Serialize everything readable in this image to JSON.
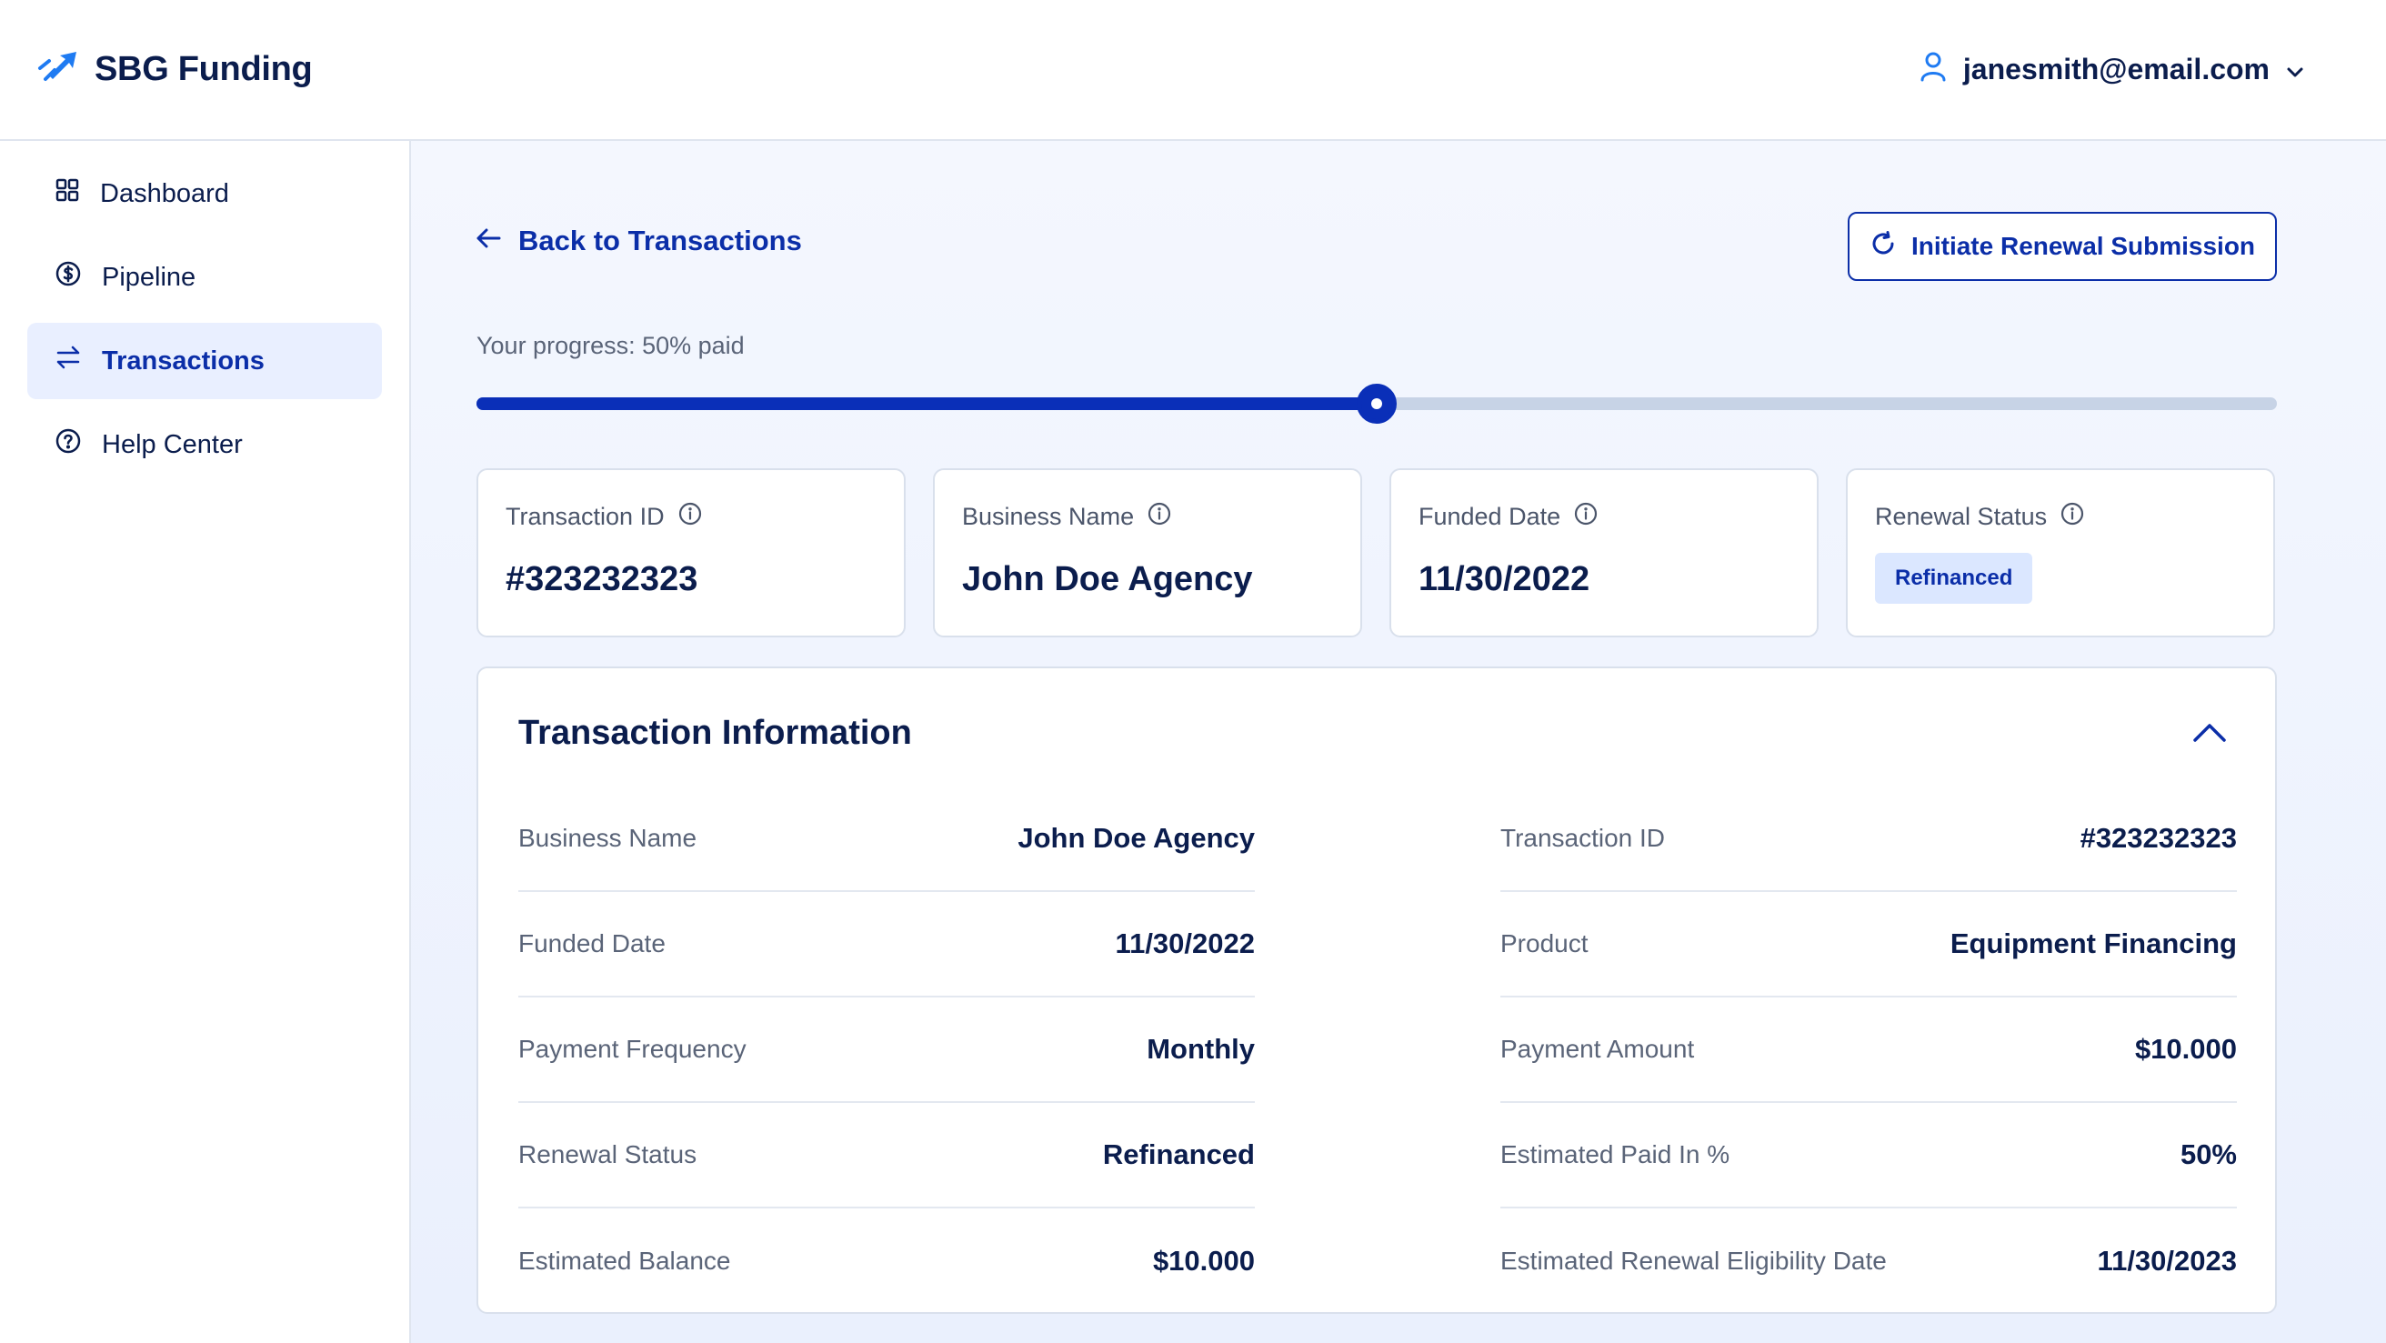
{
  "app": {
    "name": "SBG Funding",
    "logo_icon": "rocket-icon"
  },
  "user": {
    "email": "janesmith@email.com"
  },
  "sidebar": {
    "items": [
      {
        "label": "Dashboard",
        "icon": "grid-icon",
        "active": false
      },
      {
        "label": "Pipeline",
        "icon": "dollar-circle-icon",
        "active": false
      },
      {
        "label": "Transactions",
        "icon": "swap-arrows-icon",
        "active": true
      },
      {
        "label": "Help Center",
        "icon": "help-circle-icon",
        "active": false
      }
    ]
  },
  "header": {
    "back_label": "Back to Transactions",
    "renew_label": "Initiate Renewal Submission"
  },
  "progress": {
    "label": "Your progress: 50% paid",
    "percent": 50
  },
  "summary_cards": [
    {
      "label": "Transaction ID",
      "value": "#323232323"
    },
    {
      "label": "Business Name",
      "value": "John Doe Agency"
    },
    {
      "label": "Funded Date",
      "value": "11/30/2022"
    },
    {
      "label": "Renewal Status",
      "badge": "Refinanced"
    }
  ],
  "transaction_info": {
    "title": "Transaction Information",
    "left": [
      {
        "label": "Business Name",
        "value": "John Doe Agency"
      },
      {
        "label": "Funded Date",
        "value": "11/30/2022"
      },
      {
        "label": "Payment Frequency",
        "value": "Monthly"
      },
      {
        "label": "Renewal Status",
        "value": "Refinanced"
      },
      {
        "label": "Estimated Balance",
        "value": "$10.000"
      }
    ],
    "right": [
      {
        "label": "Transaction ID",
        "value": "#323232323"
      },
      {
        "label": "Product",
        "value": "Equipment Financing"
      },
      {
        "label": "Payment Amount",
        "value": "$10.000"
      },
      {
        "label": "Estimated Paid In %",
        "value": "50%"
      },
      {
        "label": "Estimated Renewal Eligibility Date",
        "value": "11/30/2023"
      }
    ]
  },
  "colors": {
    "primary": "#0b2ea8",
    "text": "#0b1d4d",
    "muted": "#5a6478",
    "badge_bg": "#dbe7ff"
  }
}
